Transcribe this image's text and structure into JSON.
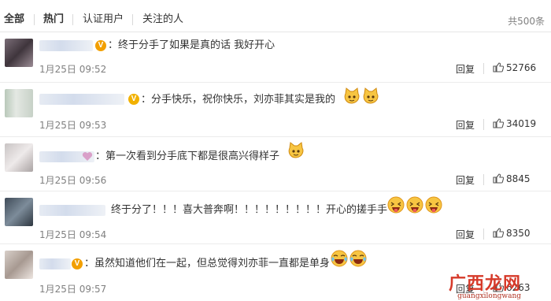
{
  "tabs": [
    "全部",
    "热门",
    "认证用户",
    "关注的人"
  ],
  "total": "共500条",
  "reply_label": "回复",
  "comments": [
    {
      "text": "：终于分手了如果是真的话 我好开心",
      "time": "1月25日 09:52",
      "likes": "52766",
      "badge": "V",
      "badge_color": "#f29f00",
      "emojis": []
    },
    {
      "text": "：分手快乐，祝你快乐，刘亦菲其实是我的",
      "time": "1月25日 09:53",
      "likes": "34019",
      "badge": "V",
      "badge_color": "#f2b100",
      "emojis": [
        "cat-face-icon",
        "cat-face-icon"
      ]
    },
    {
      "text": "：第一次看到分手底下都是很高兴得样子",
      "time": "1月25日 09:56",
      "likes": "8845",
      "badge": "heart",
      "badge_color": "#d9a0c9",
      "emojis": [
        "cat-face-icon"
      ]
    },
    {
      "text": "终于分了！！！喜大普奔啊！！！！！！！！！开心的搓手手",
      "time": "1月25日 09:54",
      "likes": "8350",
      "badge": "",
      "badge_color": "",
      "emojis": [
        "tongue-face-icon",
        "tongue-face-icon",
        "tongue-face-icon"
      ]
    },
    {
      "text": "：虽然知道他们在一起，但总觉得刘亦菲一直都是单身",
      "time": "1月25日 09:57",
      "likes": "6263",
      "badge": "V",
      "badge_color": "#f29f00",
      "emojis": [
        "crying-laugh-icon",
        "crying-laugh-icon"
      ]
    }
  ],
  "watermark": {
    "text": "广西龙网",
    "sub": "guangxilongwang"
  },
  "colors": {
    "accent": "#f29f00",
    "text": "#333333",
    "meta": "#808080"
  }
}
